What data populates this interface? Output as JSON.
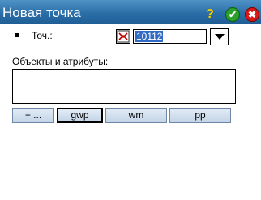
{
  "window": {
    "title": "Новая точка",
    "help_icon": "question-icon",
    "ok_icon": "check-icon",
    "close_icon": "close-icon",
    "colors": {
      "titlebar": "#2a6ea8",
      "ok": "#2aa12a",
      "close": "#d81818",
      "help": "#f5d000"
    }
  },
  "form": {
    "point_label": "Точ.:",
    "point_value": "10112",
    "type_icon": "point-type-icon",
    "dropdown_icon": "chevron-down-icon",
    "attributes_label": "Объекты и атрибуты:",
    "attributes_value": ""
  },
  "code_buttons": [
    {
      "label": "+ ..."
    },
    {
      "label": "gwp"
    },
    {
      "label": "wm"
    },
    {
      "label": "pp"
    }
  ]
}
